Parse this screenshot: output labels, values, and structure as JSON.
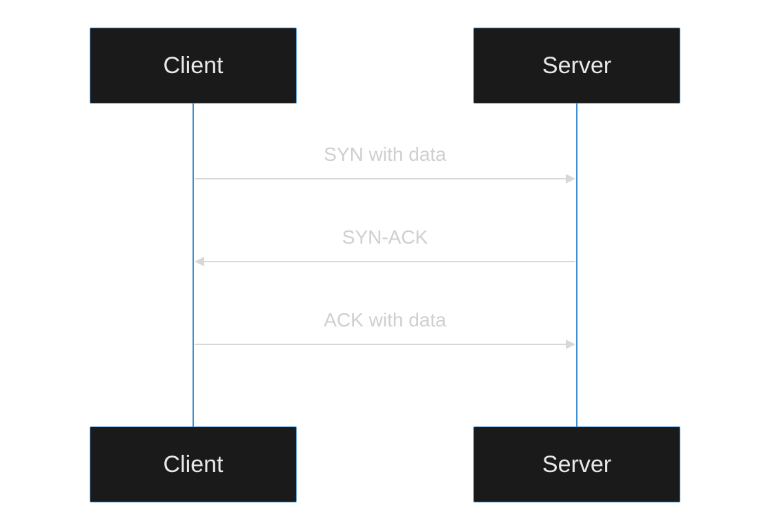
{
  "diagram": {
    "type": "sequence",
    "participants": [
      {
        "id": "client",
        "label": "Client"
      },
      {
        "id": "server",
        "label": "Server"
      }
    ],
    "messages": [
      {
        "from": "client",
        "to": "server",
        "label": "SYN with data"
      },
      {
        "from": "server",
        "to": "client",
        "label": "SYN-ACK"
      },
      {
        "from": "client",
        "to": "server",
        "label": "ACK with data"
      }
    ],
    "colors": {
      "node_fill": "#1a1a1a",
      "node_border": "#3f8ed0",
      "node_text": "#e8e8e8",
      "lifeline": "#3f8ed0",
      "arrow": "#d8d8d8",
      "message_text": "#cfcfcf",
      "background": "#ffffff"
    }
  }
}
